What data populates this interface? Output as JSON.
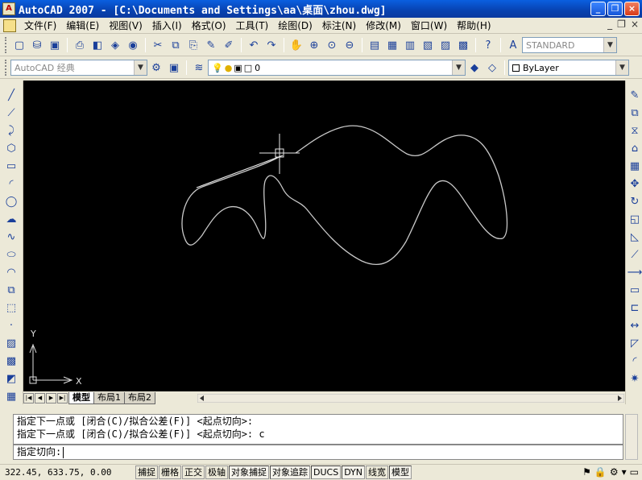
{
  "window": {
    "title": "AutoCAD 2007 - [C:\\Documents and Settings\\aa\\桌面\\zhou.dwg]",
    "app_icon": "A",
    "buttons": {
      "minimize": "_",
      "restore": "❐",
      "close": "×"
    }
  },
  "menubar": {
    "items": [
      "文件(F)",
      "编辑(E)",
      "视图(V)",
      "插入(I)",
      "格式(O)",
      "工具(T)",
      "绘图(D)",
      "标注(N)",
      "修改(M)",
      "窗口(W)",
      "帮助(H)"
    ],
    "mdi_buttons": {
      "minimize": "_",
      "restore": "❐",
      "close": "×"
    }
  },
  "toolbar": {
    "style_combo": "STANDARD"
  },
  "layers_toolbar": {
    "workspace": "AutoCAD 经典",
    "layer": "0",
    "color": "ByLayer"
  },
  "layout_tabs": {
    "nav_buttons": [
      "|◀",
      "◀",
      "▶",
      "▶|"
    ],
    "tabs": [
      "模型",
      "布局1",
      "布局2"
    ]
  },
  "ucs": {
    "x_label": "X",
    "y_label": "Y"
  },
  "command": {
    "history": [
      "指定下一点或 [闭合(C)/拟合公差(F)] <起点切向>:",
      "指定下一点或 [闭合(C)/拟合公差(F)] <起点切向>: c"
    ],
    "prompt": "指定切向:"
  },
  "status": {
    "coords": "322.45, 633.75, 0.00",
    "buttons": [
      "捕捉",
      "栅格",
      "正交",
      "极轴",
      "对象捕捉",
      "对象追踪",
      "DUCS",
      "DYN",
      "线宽",
      "模型"
    ]
  },
  "colors": {
    "canvas": "#000000",
    "spline": "#c8c8c8",
    "titlebar": "#0a5fe0"
  }
}
